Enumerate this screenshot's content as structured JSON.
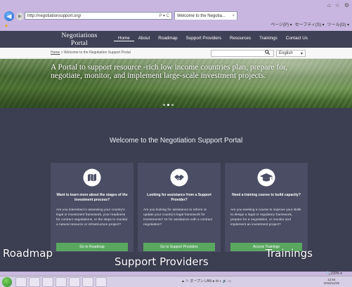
{
  "browser": {
    "url": "http://negotiationsupport.org/",
    "address_controls": "P ▾ C",
    "tab_title": "Welcome to the Negotia...",
    "tab_close": "×",
    "window_controls": [
      "⌂",
      "☆",
      "⚙"
    ],
    "menu_bar": [
      "ページ(P) ▾",
      "セーフティ(S) ▾",
      "ツール(O) ▾"
    ]
  },
  "site": {
    "logo_main": "Negotiations Portal",
    "logo_sub": "for Host Country Governments",
    "nav": [
      "Home",
      "About",
      "Roadmap",
      "Support Providers",
      "Resources",
      "Trainings",
      "Contact Us"
    ],
    "active_nav": "Home",
    "breadcrumb": [
      "Home",
      " > Welcome to the Negotiation Support Portal"
    ],
    "language": "English",
    "language_caret": "▾",
    "hero_text": "A Portal to support resource -rich low income countries plan, prepare for, negotiate, monitor, and implement large-scale investment projects."
  },
  "main": {
    "welcome_title": "Welcome to the Negotiation Support Portal",
    "cards": [
      {
        "icon": "map-icon",
        "title": "Want to learn more about the stages of the investment process?",
        "body": "Are you interested in assessing your country's legal or investment framework, your readiness for contract negotiations, or the steps to monitor a natural resource or infrastructure project?",
        "button": "Go to Roadmap"
      },
      {
        "icon": "handshake-icon",
        "title": "Looking for assistance from a Support Provider?",
        "body": "Are you looking for assistance to reform or update your country's legal framework for investments? Or for assistance with a contract negotiation?",
        "button": "Go to Support Providers"
      },
      {
        "icon": "graduation-cap-icon",
        "title": "Need a training course to build capacity?",
        "body": "Are you seeking a course to improve your skills to design a legal or regulatory framework, prepare for a negotiation, or monitor and implement an investment project?",
        "button": "Access Trainings"
      }
    ]
  },
  "overlay_labels": [
    "Roadmap",
    "Support Providers",
    "Trainings"
  ],
  "status": {
    "zoom": "🔍100% ▾"
  },
  "taskbar": {
    "tray_text": "▲ ⚐ オープン LAN ● ✉ ◐ 🔊 ▭",
    "time": "12:54",
    "date": "2016/11/26"
  },
  "colors": {
    "header_bg": "#3f4157",
    "band_bg": "#3c3f52",
    "card_bg": "#4a4d63",
    "button_green": "#5aa860"
  }
}
